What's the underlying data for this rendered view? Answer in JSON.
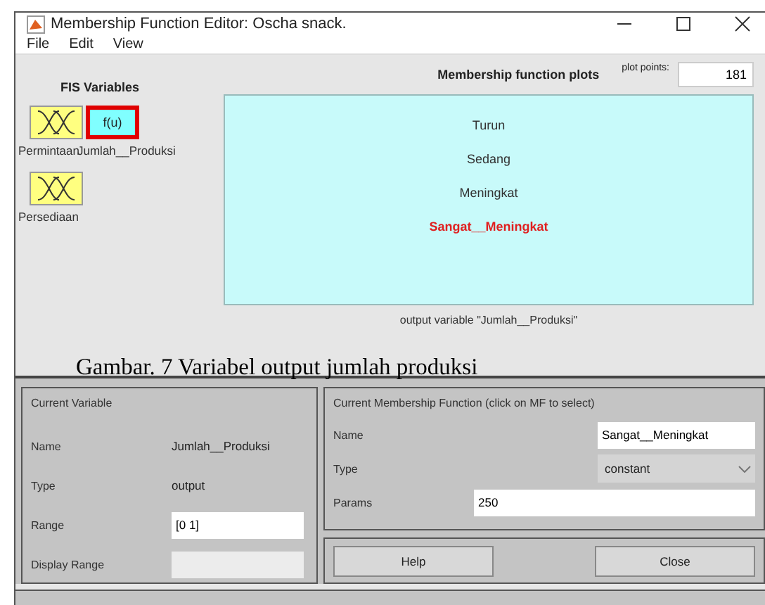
{
  "window": {
    "title": "Membership Function Editor: Oscha snack."
  },
  "menu": [
    "File",
    "Edit",
    "View"
  ],
  "fis_variables": {
    "title": "FIS Variables",
    "items": [
      {
        "kind": "input",
        "label": "Permintaan",
        "selected": false
      },
      {
        "kind": "output",
        "label": "Jumlah__Produksi",
        "icon_text": "f(u)",
        "selected": true
      },
      {
        "kind": "input",
        "label": "Persediaan",
        "selected": false
      }
    ]
  },
  "plot": {
    "title": "Membership function plots",
    "plot_points_label": "plot points:",
    "plot_points": "181",
    "membership_functions": [
      {
        "name": "Turun",
        "selected": false
      },
      {
        "name": "Sedang",
        "selected": false
      },
      {
        "name": "Meningkat",
        "selected": false
      },
      {
        "name": "Sangat__Meningkat",
        "selected": true
      }
    ],
    "caption": "output variable \"Jumlah__Produksi\""
  },
  "figure_caption": "Gambar. 7 Variabel output jumlah produksi",
  "current_variable": {
    "title": "Current Variable",
    "name_label": "Name",
    "name": "Jumlah__Produksi",
    "type_label": "Type",
    "type": "output",
    "range_label": "Range",
    "range": "[0 1]",
    "display_range_label": "Display Range"
  },
  "current_mf": {
    "title": "Current Membership Function (click on MF to select)",
    "name_label": "Name",
    "name": "Sangat__Meningkat",
    "type_label": "Type",
    "type": "constant",
    "params_label": "Params",
    "params": "250"
  },
  "buttons": [
    "Help",
    "Close"
  ]
}
